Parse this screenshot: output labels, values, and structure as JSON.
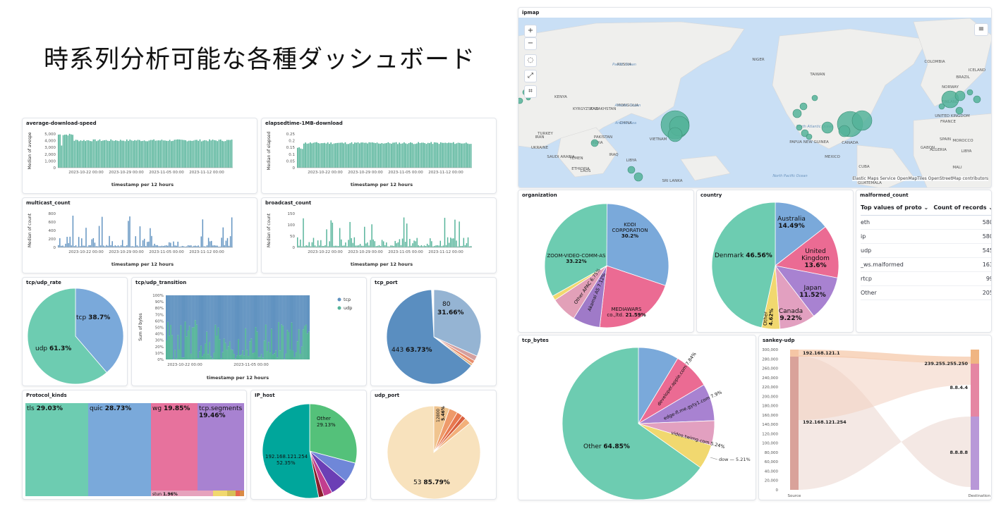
{
  "page_heading": "時系列分析可能な各種ダッシュボード",
  "colors": {
    "green": "#54b399",
    "blue": "#6092c0",
    "pink": "#e7729d",
    "purple": "#9170b8",
    "yellow": "#f1d86f",
    "lightblue": "#7aa9da",
    "teal": "#00a69b",
    "peach": "#f6ddb8"
  },
  "panels": {
    "avg_dl": {
      "title": "average-download-speed",
      "ylabel": "Median of avespe",
      "xlabel": "timestamp per 12 hours",
      "yticks": [
        "5,000",
        "4,000",
        "3,000",
        "2,000",
        "1,000",
        "0"
      ],
      "xticks": [
        "2023-10-22 00:00",
        "2023-10-29 00:00",
        "2023-11-05 00:00",
        "2023-11-12 00:00"
      ]
    },
    "elapsed": {
      "title": "elapsedtime-1MB-download",
      "ylabel": "Median of elapsed",
      "xlabel": "timestamp per 12 hours",
      "yticks": [
        "0.25",
        "0.2",
        "0.15",
        "0.1",
        "0.05",
        "0"
      ],
      "xticks": [
        "2023-10-22 00:00",
        "2023-10-29 00:00",
        "2023-11-05 00:00",
        "2023-11-12 00:00"
      ]
    },
    "multicast": {
      "title": "multicast_count",
      "ylabel": "Median of count",
      "xlabel": "timestamp per 12 hours",
      "yticks": [
        "800",
        "600",
        "400",
        "200",
        "0"
      ],
      "xticks": [
        "2023-10-22 00:00",
        "2023-10-29 00:00",
        "2023-11-05 00:00",
        "2023-11-12 00:00"
      ]
    },
    "broadcast": {
      "title": "broadcast_count",
      "ylabel": "Median of count",
      "xlabel": "timestamp per 12 hours",
      "yticks": [
        "150",
        "100",
        "50",
        "0"
      ],
      "xticks": [
        "2023-10-22 00:00",
        "2023-10-29 00:00",
        "2023-11-05 00:00",
        "2023-11-12 00:00"
      ]
    },
    "tcpudp_rate": {
      "title": "tcp/udp_rate",
      "slices": [
        {
          "label": "tcp",
          "pct": "38.7%"
        },
        {
          "label": "udp",
          "pct": "61.3%"
        }
      ]
    },
    "tcpudp_transition": {
      "title": "tcp/udp_transition",
      "ylabel": "Sum of bytes",
      "xlabel": "timestamp per 12 hours",
      "yticks": [
        "100%",
        "90%",
        "80%",
        "70%",
        "60%",
        "50%",
        "40%",
        "30%",
        "20%",
        "10%",
        "0%"
      ],
      "xticks": [
        "2023-10-22 00:00",
        "2023-11-05 00:00"
      ],
      "legend": [
        "tcp",
        "udp"
      ]
    },
    "tcp_port": {
      "title": "tcp_port",
      "slices": [
        {
          "label": "80",
          "pct": "31.66%"
        },
        {
          "label": "443",
          "pct": "63.73%"
        }
      ]
    },
    "protocol_kinds": {
      "title": "Protocol_kinds",
      "cells": [
        {
          "label": "tls",
          "pct": "29.03%"
        },
        {
          "label": "quic",
          "pct": "28.73%"
        },
        {
          "label": "wg",
          "pct": "19.85%"
        },
        {
          "label": "tcp.segments",
          "pct": "19.46%"
        },
        {
          "label": "stun",
          "pct": "1.96%"
        }
      ]
    },
    "ip_host": {
      "title": "IP_host",
      "slices": [
        {
          "label": "Other",
          "pct": "29.13%"
        },
        {
          "label": "192.168.121.254",
          "pct": "52.35%"
        }
      ]
    },
    "udp_port": {
      "title": "udp_port",
      "slices": [
        {
          "label": "12800",
          "pct": "5.46%"
        },
        {
          "label": "53",
          "pct": "85.79%"
        }
      ]
    },
    "ipmap": {
      "title": "ipmap",
      "attribution": "Elastic Maps Service  OpenMapTiles  OpenStreetMap contributors",
      "labels": [
        "RUSSIA",
        "MONGOLIA",
        "CHINA",
        "KAZAKHSTAN",
        "KYRGYZSTAN",
        "PAKISTAN",
        "INDIA",
        "IRAN",
        "TURKEY",
        "SAUDI ARABIA",
        "YEMEN",
        "ETHIOPIA",
        "KENYA",
        "UKRAINE",
        "IRAQ",
        "LIBYA",
        "LAOS",
        "VIETNAM",
        "SRI LANKA",
        "TAIWAN",
        "PAPUA NEW GUINEA",
        "CANADA",
        "MEXICO",
        "CUBA",
        "GUATEMALA",
        "COLOMBIA",
        "BRAZIL",
        "ICELAND",
        "NORWAY",
        "FINLAND",
        "UNITED KINGDOM",
        "FRANCE",
        "SPAIN",
        "MOROCCO",
        "ALGERIA",
        "LIBYA",
        "MALI",
        "NIGER",
        "GABON",
        "North Pacific Ocean",
        "North Atlantic Ocean",
        "Pacific Ocean",
        "Atlantic Ocean",
        "Arabian Sea"
      ]
    },
    "organization": {
      "title": "organization",
      "slices": [
        {
          "label": "KDDI CORPORATION",
          "pct": "30.2%"
        },
        {
          "label": "MEDIAWARS co.,ltd.",
          "pct": "21.59%"
        },
        {
          "label": "Akamai AS",
          "pct": "7.12%"
        },
        {
          "label": "Other APAC",
          "pct": "6.75%"
        },
        {
          "label": "ZOOM-VIDEO-COMM-AS",
          "pct": "33.22%"
        }
      ]
    },
    "country": {
      "title": "country",
      "slices": [
        {
          "label": "Australia",
          "pct": "14.49%"
        },
        {
          "label": "United Kingdom",
          "pct": "13.6%"
        },
        {
          "label": "Japan",
          "pct": "11.52%"
        },
        {
          "label": "Canada",
          "pct": "9.22%"
        },
        {
          "label": "Other",
          "pct": "4.62%"
        },
        {
          "label": "Denmark",
          "pct": "46.56%"
        }
      ]
    },
    "malformed": {
      "title": "malformed_count",
      "col1": "Top values of proto",
      "col2": "Count of records",
      "rows": [
        {
          "k": "eth",
          "v": "580"
        },
        {
          "k": "ip",
          "v": "580"
        },
        {
          "k": "udp",
          "v": "545"
        },
        {
          "k": "_ws.malformed",
          "v": "163"
        },
        {
          "k": "rtcp",
          "v": "99"
        },
        {
          "k": "Other",
          "v": "205"
        }
      ]
    },
    "tcp_bytes": {
      "title": "tcp_bytes",
      "slices": [
        {
          "label": "developer.apple.com",
          "pct": "7.84%"
        },
        {
          "label": "edge-fl.me.gyty1.com",
          "pct": "7.9%"
        },
        {
          "label": "video.twimg.com",
          "pct": "5.24%"
        },
        {
          "label": "dow",
          "pct": "5.21%"
        },
        {
          "label": "Other",
          "pct": "64.85%"
        }
      ]
    },
    "sankey": {
      "title": "sankey-udp",
      "yticks": [
        "300,000",
        "280,000",
        "260,000",
        "240,000",
        "220,000",
        "200,000",
        "180,000",
        "160,000",
        "140,000",
        "120,000",
        "100,000",
        "80,000",
        "60,000",
        "40,000",
        "20,000",
        "0"
      ],
      "nodes": [
        "192.168.121.1",
        "239.255.255.250",
        "8.8.4.4",
        "192.168.121.254",
        "8.8.8.8"
      ],
      "xlabels": [
        "Source",
        "Destination"
      ]
    }
  }
}
